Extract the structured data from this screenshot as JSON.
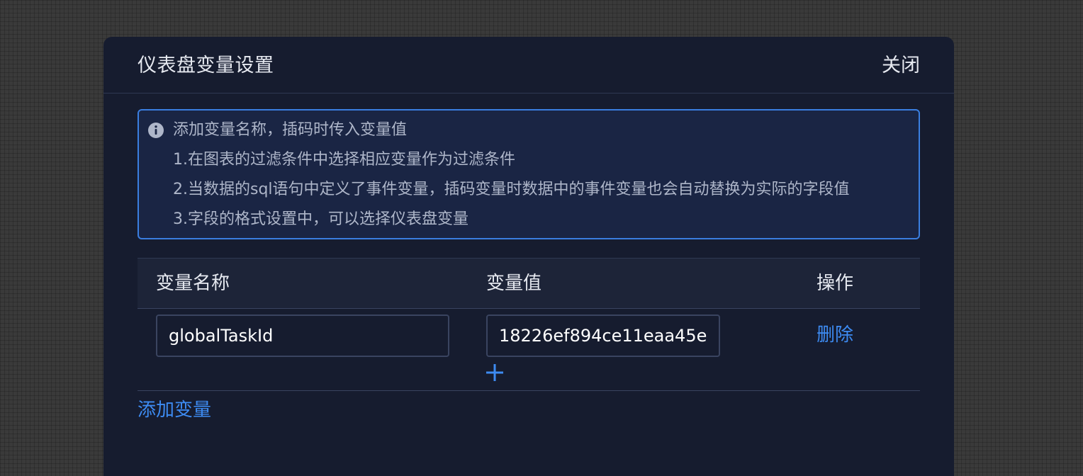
{
  "dialog": {
    "title": "仪表盘变量设置",
    "close_label": "关闭"
  },
  "notice": {
    "icon": "info-icon",
    "lines": [
      "添加变量名称，插码时传入变量值",
      "1.在图表的过滤条件中选择相应变量作为过滤条件",
      "2.当数据的sql语句中定义了事件变量，插码变量时数据中的事件变量也会自动替换为实际的字段值",
      "3.字段的格式设置中，可以选择仪表盘变量"
    ]
  },
  "table": {
    "headers": [
      "变量名称",
      "变量值",
      "操作"
    ],
    "rows": [
      {
        "name": "globalTaskId",
        "value": "18226ef894ce11eaa45e",
        "action_label": "删除"
      }
    ]
  },
  "add_variable_label": "添加变量",
  "colors": {
    "background": "#161c2f",
    "accent": "#3d8bf2",
    "notice_border": "#3a7ee0"
  }
}
